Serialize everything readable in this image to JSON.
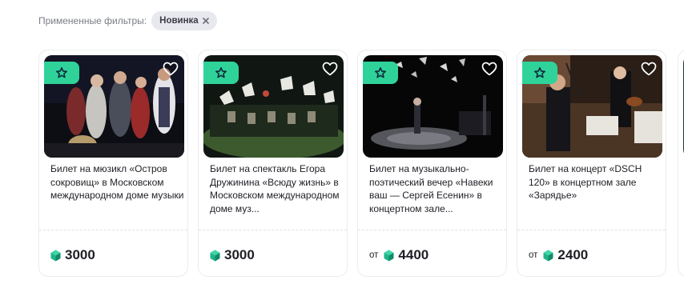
{
  "filters": {
    "label": "Примененные фильтры:",
    "chips": [
      {
        "label": "Новинка"
      }
    ]
  },
  "cards": [
    {
      "title": "Билет на мюзикл «Остров сокровищ» в Московском международном доме музыки",
      "price_prefix": "",
      "price": "3000",
      "badge_icon": "star-icon",
      "favorite_icon": "heart-icon"
    },
    {
      "title": "Билет на спектакль Егора Дружинина «Всюду жизнь» в Московском международном доме муз...",
      "price_prefix": "",
      "price": "3000",
      "badge_icon": "star-icon",
      "favorite_icon": "heart-icon"
    },
    {
      "title": "Билет на музыкально-поэтический вечер «Навеки ваш — Сергей Есенин» в концертном зале...",
      "price_prefix": "от",
      "price": "4400",
      "badge_icon": "star-icon",
      "favorite_icon": "heart-icon"
    },
    {
      "title": "Билет на концерт «DSCH 120» в концертном зале «Зарядье»",
      "price_prefix": "от",
      "price": "2400",
      "badge_icon": "star-icon",
      "favorite_icon": "heart-icon"
    }
  ],
  "colors": {
    "badge": "#2fd39a",
    "gem": "#1fb58a",
    "chip_bg": "#e8e9ee"
  }
}
